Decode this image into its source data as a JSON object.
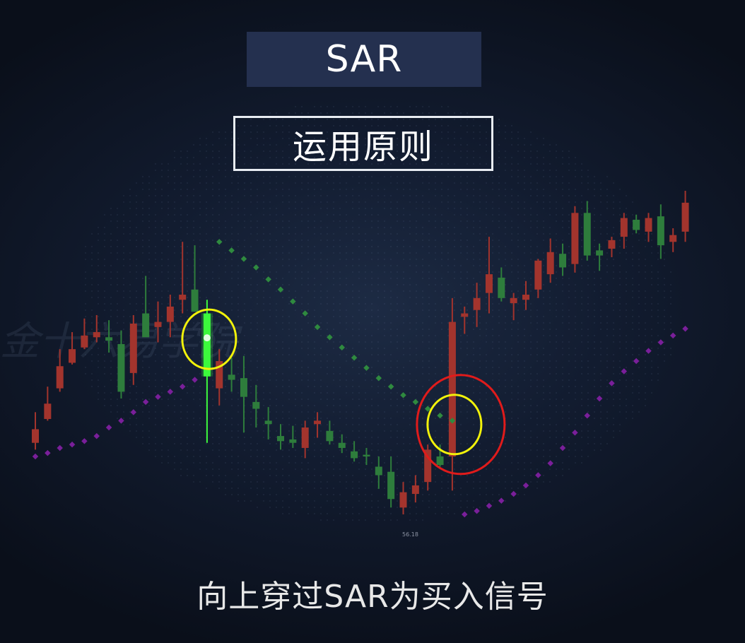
{
  "header": {
    "title": "SAR",
    "subtitle": "运用原则"
  },
  "caption": "向上穿过SAR为买入信号",
  "watermark": "金十六易学院",
  "price_label": "56.18",
  "colors": {
    "bull": "#2e7d3c",
    "bear": "#a3342d",
    "highlight": "#3dfa3d",
    "sar_above": "#2f8a3f",
    "sar_below": "#7a1f9a",
    "yellow_mark": "#f2f20a",
    "red_mark": "#e01b1b"
  },
  "chart_data": {
    "type": "candlestick",
    "title": "SAR",
    "ylim": [
      95,
      290
    ],
    "candles": [
      {
        "o": 150,
        "h": 160,
        "l": 138,
        "c": 142,
        "dir": "bear"
      },
      {
        "o": 165,
        "h": 175,
        "l": 155,
        "c": 156,
        "dir": "bear"
      },
      {
        "o": 187,
        "h": 197,
        "l": 172,
        "c": 174,
        "dir": "bear"
      },
      {
        "o": 197,
        "h": 207,
        "l": 188,
        "c": 189,
        "dir": "bear"
      },
      {
        "o": 205,
        "h": 215,
        "l": 197,
        "c": 198,
        "dir": "bear"
      },
      {
        "o": 207,
        "h": 217,
        "l": 201,
        "c": 204,
        "dir": "bear"
      },
      {
        "o": 204,
        "h": 214,
        "l": 195,
        "c": 202,
        "dir": "bull"
      },
      {
        "o": 200,
        "h": 208,
        "l": 168,
        "c": 172,
        "dir": "bull"
      },
      {
        "o": 183,
        "h": 217,
        "l": 176,
        "c": 212,
        "dir": "bear"
      },
      {
        "o": 218,
        "h": 240,
        "l": 210,
        "c": 204,
        "dir": "bull"
      },
      {
        "o": 210,
        "h": 225,
        "l": 201,
        "c": 213,
        "dir": "bear"
      },
      {
        "o": 213,
        "h": 229,
        "l": 204,
        "c": 222,
        "dir": "bear"
      },
      {
        "o": 229,
        "h": 260,
        "l": 218,
        "c": 226,
        "dir": "bear"
      },
      {
        "o": 232,
        "h": 258,
        "l": 222,
        "c": 219,
        "dir": "bull"
      },
      {
        "o": 218,
        "h": 226,
        "l": 142,
        "c": 181,
        "dir": "highlight"
      },
      {
        "o": 190,
        "h": 197,
        "l": 164,
        "c": 174,
        "dir": "bear"
      },
      {
        "o": 182,
        "h": 192,
        "l": 172,
        "c": 179,
        "dir": "bull"
      },
      {
        "o": 180,
        "h": 193,
        "l": 148,
        "c": 169,
        "dir": "bull"
      },
      {
        "o": 166,
        "h": 176,
        "l": 151,
        "c": 162,
        "dir": "bull"
      },
      {
        "o": 153,
        "h": 163,
        "l": 144,
        "c": 155,
        "dir": "bull"
      },
      {
        "o": 146,
        "h": 153,
        "l": 138,
        "c": 143,
        "dir": "bull"
      },
      {
        "o": 144,
        "h": 152,
        "l": 139,
        "c": 142,
        "dir": "bull"
      },
      {
        "o": 139,
        "h": 155,
        "l": 133,
        "c": 151,
        "dir": "bear"
      },
      {
        "o": 155,
        "h": 160,
        "l": 145,
        "c": 153,
        "dir": "bear"
      },
      {
        "o": 149,
        "h": 155,
        "l": 141,
        "c": 143,
        "dir": "bull"
      },
      {
        "o": 142,
        "h": 147,
        "l": 136,
        "c": 139,
        "dir": "bull"
      },
      {
        "o": 137,
        "h": 143,
        "l": 131,
        "c": 133,
        "dir": "bull"
      },
      {
        "o": 135,
        "h": 139,
        "l": 129,
        "c": 134,
        "dir": "bull"
      },
      {
        "o": 128,
        "h": 134,
        "l": 115,
        "c": 123,
        "dir": "bull"
      },
      {
        "o": 125,
        "h": 134,
        "l": 104,
        "c": 109,
        "dir": "bull"
      },
      {
        "o": 104,
        "h": 119,
        "l": 100,
        "c": 113,
        "dir": "bear"
      },
      {
        "o": 112,
        "h": 123,
        "l": 107,
        "c": 117,
        "dir": "bear"
      },
      {
        "o": 119,
        "h": 141,
        "l": 114,
        "c": 138,
        "dir": "bear"
      },
      {
        "o": 134,
        "h": 141,
        "l": 128,
        "c": 129,
        "dir": "bull"
      },
      {
        "o": 134,
        "h": 227,
        "l": 114,
        "c": 213,
        "dir": "bear"
      },
      {
        "o": 216,
        "h": 222,
        "l": 206,
        "c": 218,
        "dir": "bear"
      },
      {
        "o": 220,
        "h": 236,
        "l": 210,
        "c": 227,
        "dir": "bear"
      },
      {
        "o": 241,
        "h": 263,
        "l": 218,
        "c": 230,
        "dir": "bear"
      },
      {
        "o": 239,
        "h": 245,
        "l": 225,
        "c": 227,
        "dir": "bull"
      },
      {
        "o": 224,
        "h": 230,
        "l": 214,
        "c": 227,
        "dir": "bear"
      },
      {
        "o": 226,
        "h": 237,
        "l": 220,
        "c": 229,
        "dir": "bear"
      },
      {
        "o": 232,
        "h": 250,
        "l": 227,
        "c": 249,
        "dir": "bear"
      },
      {
        "o": 241,
        "h": 262,
        "l": 236,
        "c": 254,
        "dir": "bear"
      },
      {
        "o": 253,
        "h": 259,
        "l": 240,
        "c": 245,
        "dir": "bull"
      },
      {
        "o": 247,
        "h": 281,
        "l": 242,
        "c": 277,
        "dir": "bear"
      },
      {
        "o": 277,
        "h": 284,
        "l": 249,
        "c": 252,
        "dir": "bull"
      },
      {
        "o": 252,
        "h": 259,
        "l": 243,
        "c": 255,
        "dir": "bull"
      },
      {
        "o": 256,
        "h": 263,
        "l": 251,
        "c": 261,
        "dir": "bear"
      },
      {
        "o": 263,
        "h": 277,
        "l": 256,
        "c": 274,
        "dir": "bear"
      },
      {
        "o": 273,
        "h": 276,
        "l": 265,
        "c": 267,
        "dir": "bull"
      },
      {
        "o": 266,
        "h": 277,
        "l": 260,
        "c": 274,
        "dir": "bear"
      },
      {
        "o": 275,
        "h": 282,
        "l": 250,
        "c": 258,
        "dir": "bull"
      },
      {
        "o": 260,
        "h": 268,
        "l": 254,
        "c": 264,
        "dir": "bear"
      },
      {
        "o": 266,
        "h": 290,
        "l": 260,
        "c": 283,
        "dir": "bear"
      }
    ],
    "sar": [
      {
        "i": 0,
        "v": 134,
        "pos": "below"
      },
      {
        "i": 1,
        "v": 136,
        "pos": "below"
      },
      {
        "i": 2,
        "v": 139,
        "pos": "below"
      },
      {
        "i": 3,
        "v": 141,
        "pos": "below"
      },
      {
        "i": 4,
        "v": 143,
        "pos": "below"
      },
      {
        "i": 5,
        "v": 146,
        "pos": "below"
      },
      {
        "i": 6,
        "v": 151,
        "pos": "below"
      },
      {
        "i": 7,
        "v": 155,
        "pos": "below"
      },
      {
        "i": 8,
        "v": 160,
        "pos": "below"
      },
      {
        "i": 9,
        "v": 166,
        "pos": "below"
      },
      {
        "i": 10,
        "v": 169,
        "pos": "below"
      },
      {
        "i": 11,
        "v": 172,
        "pos": "below"
      },
      {
        "i": 12,
        "v": 175,
        "pos": "below"
      },
      {
        "i": 13,
        "v": 179,
        "pos": "below"
      },
      {
        "i": 15,
        "v": 260,
        "pos": "above"
      },
      {
        "i": 16,
        "v": 255,
        "pos": "above"
      },
      {
        "i": 17,
        "v": 250,
        "pos": "above"
      },
      {
        "i": 18,
        "v": 245,
        "pos": "above"
      },
      {
        "i": 19,
        "v": 238,
        "pos": "above"
      },
      {
        "i": 20,
        "v": 232,
        "pos": "above"
      },
      {
        "i": 21,
        "v": 225,
        "pos": "above"
      },
      {
        "i": 22,
        "v": 218,
        "pos": "above"
      },
      {
        "i": 23,
        "v": 210,
        "pos": "above"
      },
      {
        "i": 24,
        "v": 204,
        "pos": "above"
      },
      {
        "i": 25,
        "v": 198,
        "pos": "above"
      },
      {
        "i": 26,
        "v": 192,
        "pos": "above"
      },
      {
        "i": 27,
        "v": 186,
        "pos": "above"
      },
      {
        "i": 28,
        "v": 180,
        "pos": "above"
      },
      {
        "i": 29,
        "v": 175,
        "pos": "above"
      },
      {
        "i": 30,
        "v": 170,
        "pos": "above"
      },
      {
        "i": 31,
        "v": 166,
        "pos": "above"
      },
      {
        "i": 32,
        "v": 162,
        "pos": "above"
      },
      {
        "i": 33,
        "v": 158,
        "pos": "above"
      },
      {
        "i": 34,
        "v": 155,
        "pos": "above"
      },
      {
        "i": 35,
        "v": 100,
        "pos": "below"
      },
      {
        "i": 36,
        "v": 102,
        "pos": "below"
      },
      {
        "i": 37,
        "v": 105,
        "pos": "below"
      },
      {
        "i": 38,
        "v": 108,
        "pos": "below"
      },
      {
        "i": 39,
        "v": 112,
        "pos": "below"
      },
      {
        "i": 40,
        "v": 117,
        "pos": "below"
      },
      {
        "i": 41,
        "v": 123,
        "pos": "below"
      },
      {
        "i": 42,
        "v": 130,
        "pos": "below"
      },
      {
        "i": 43,
        "v": 139,
        "pos": "below"
      },
      {
        "i": 44,
        "v": 148,
        "pos": "below"
      },
      {
        "i": 45,
        "v": 158,
        "pos": "below"
      },
      {
        "i": 46,
        "v": 168,
        "pos": "below"
      },
      {
        "i": 47,
        "v": 177,
        "pos": "below"
      },
      {
        "i": 48,
        "v": 184,
        "pos": "below"
      },
      {
        "i": 49,
        "v": 190,
        "pos": "below"
      },
      {
        "i": 50,
        "v": 196,
        "pos": "below"
      },
      {
        "i": 51,
        "v": 201,
        "pos": "below"
      },
      {
        "i": 52,
        "v": 205,
        "pos": "below"
      },
      {
        "i": 53,
        "v": 209,
        "pos": "below"
      }
    ],
    "annotations": [
      {
        "type": "yellow-ring",
        "candle": 14
      },
      {
        "type": "yellow-ring",
        "candle": 34
      },
      {
        "type": "red-ring",
        "candle": 34
      }
    ]
  }
}
